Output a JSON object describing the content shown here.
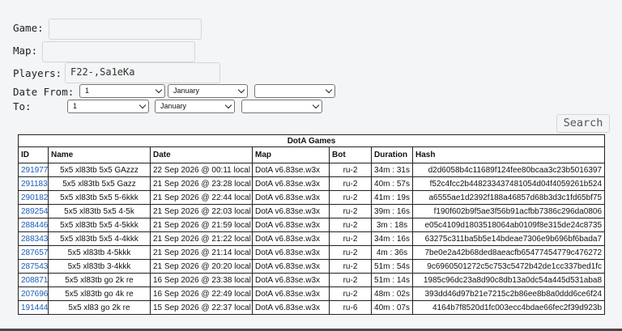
{
  "form": {
    "game_label": "Game:",
    "game_value": "",
    "map_label": "Map:",
    "map_value": "",
    "players_label": "Players:",
    "players_value": "F22-,Sa1eKa",
    "date_from_label": "Date From:",
    "date_to_label": "To:",
    "date_from": {
      "day": "1",
      "month": "January",
      "year": ""
    },
    "date_to": {
      "day": "1",
      "month": "January",
      "year": ""
    },
    "search_label": "Search"
  },
  "table": {
    "caption": "DotA Games",
    "columns": [
      "ID",
      "Name",
      "Date",
      "Map",
      "Bot",
      "Duration",
      "Hash"
    ],
    "rows": [
      {
        "id": "291977",
        "name": "5x5 xl83tb 5x5 GAzzz",
        "date": "22 Sep 2026 @ 00:11 local",
        "map": "DotA v6.83se.w3x",
        "bot": "ru-2",
        "duration": "34m : 31s",
        "hash": "d2d6058b4c11689f124fee80bcaa3c23b5016397"
      },
      {
        "id": "291183",
        "name": "5x5 xl83tb 5x5 Gazz",
        "date": "21 Sep 2026 @ 23:28 local",
        "map": "DotA v6.83se.w3x",
        "bot": "ru-2",
        "duration": "40m : 57s",
        "hash": "f52c4fcc2b448233437481054d04f4059261b524"
      },
      {
        "id": "290182",
        "name": "5x5 xl83tb 5x5 5-6kkk",
        "date": "21 Sep 2026 @ 22:44 local",
        "map": "DotA v6.83se.w3x",
        "bot": "ru-2",
        "duration": "41m : 19s",
        "hash": "a6555ae1d2392f188a46857d68b3d3c1fd65bf75"
      },
      {
        "id": "289254",
        "name": "5x5 xl83tb 5x5 4-5k",
        "date": "21 Sep 2026 @ 22:03 local",
        "map": "DotA v6.83se.w3x",
        "bot": "ru-2",
        "duration": "39m : 16s",
        "hash": "f190f602b9f5ae3f56b91acfbb7386c296da0806"
      },
      {
        "id": "288446",
        "name": "5x5 xl83tb 5x5 4-5kkk",
        "date": "21 Sep 2026 @ 21:59 local",
        "map": "DotA v6.83se.w3x",
        "bot": "ru-2",
        "duration": "3m : 18s",
        "hash": "e05c4109d1803518064ab0109f8e315de24c8735"
      },
      {
        "id": "288343",
        "name": "5x5 xl83tb 5x5 4-4kkk",
        "date": "21 Sep 2026 @ 21:22 local",
        "map": "DotA v6.83se.w3x",
        "bot": "ru-2",
        "duration": "34m : 16s",
        "hash": "63275c311ba5b5e14bdeae7306e9b696bf6bada7"
      },
      {
        "id": "287657",
        "name": "5x5 xl83tb 4-5kkk",
        "date": "21 Sep 2026 @ 21:14 local",
        "map": "DotA v6.83se.w3x",
        "bot": "ru-2",
        "duration": "4m : 36s",
        "hash": "7be0e2a42b68ded8aeacfb65477454779c476272"
      },
      {
        "id": "287543",
        "name": "5x5 xl83tb 3-4kkk",
        "date": "21 Sep 2026 @ 20:20 local",
        "map": "DotA v6.83se.w3x",
        "bot": "ru-2",
        "duration": "51m : 54s",
        "hash": "9c6960501272c5c753c5472b42de1cc337bed1fc"
      },
      {
        "id": "208871",
        "name": "5x5 xl83tb go 2k re",
        "date": "16 Sep 2026 @ 23:38 local",
        "map": "DotA v6.83se.w3x",
        "bot": "ru-2",
        "duration": "51m : 14s",
        "hash": "1985c96dc23a8d90c8db13a0dc54a445d531aba8"
      },
      {
        "id": "207696",
        "name": "5x5 xl83tb go 4k re",
        "date": "16 Sep 2026 @ 22:49 local",
        "map": "DotA v6.83se.w3x",
        "bot": "ru-2",
        "duration": "48m : 02s",
        "hash": "393dd46d97b21e7215c2b86ee8b8a0ddd6ce6f24"
      },
      {
        "id": "191444",
        "name": "5x5 xl83 go 2k re",
        "date": "15 Sep 2026 @ 22:37 local",
        "map": "DotA v6.83se.w3x",
        "bot": "ru-6",
        "duration": "40m : 07s",
        "hash": "4164b7f8520d1fc003ecc4bdae66fec2f39d923b"
      }
    ]
  },
  "colors": {
    "link": "#1a5bb6",
    "background": "#f4f5f6"
  }
}
